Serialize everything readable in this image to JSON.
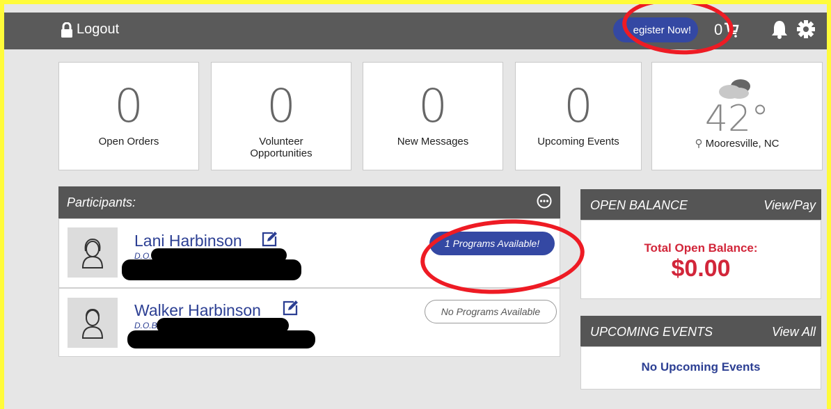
{
  "topbar": {
    "logout_label": "Logout",
    "register_label": "egister Now!",
    "cart_count": "0"
  },
  "stats": [
    {
      "value": "0",
      "label": "Open Orders"
    },
    {
      "value": "0",
      "label": "Volunteer Opportunities"
    },
    {
      "value": "0",
      "label": "New Messages"
    },
    {
      "value": "0",
      "label": "Upcoming Events"
    }
  ],
  "weather": {
    "temp": "42°",
    "location": "Mooresville, NC",
    "icon": "cloud-icon"
  },
  "participants": {
    "title": "Participants:",
    "rows": [
      {
        "name": "Lani Harbinson",
        "dob_label": "D.O.B:",
        "programs": "1 Programs Available!"
      },
      {
        "name": "Walker Harbinson",
        "dob_label": "D.O.B:",
        "programs": "No Programs Available"
      }
    ]
  },
  "balance": {
    "title": "OPEN BALANCE",
    "link": "View/Pay",
    "label": "Total Open Balance:",
    "amount": "$0.00"
  },
  "events": {
    "title": "UPCOMING EVENTS",
    "link": "View All",
    "empty": "No Upcoming Events"
  },
  "colors": {
    "accent": "#3448a3",
    "header": "#555555",
    "balance_red": "#d2263a",
    "annotation_red": "#ee1b24",
    "frame_yellow": "#fffb3a"
  }
}
